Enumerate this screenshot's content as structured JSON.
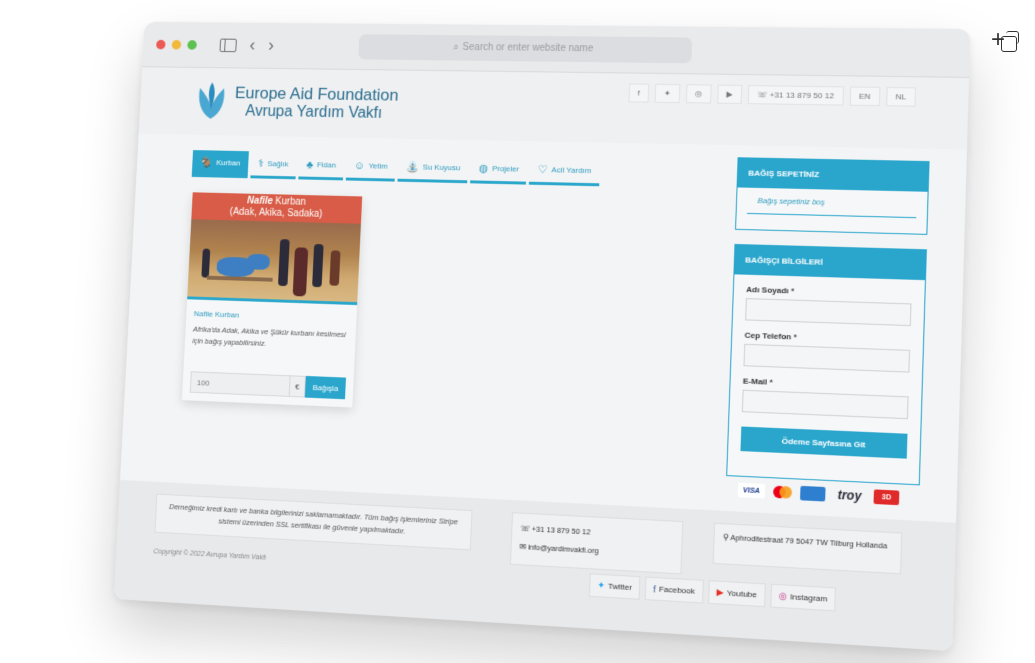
{
  "browser": {
    "address_placeholder": "Search or enter website name"
  },
  "brand": {
    "line1": "Europe Aid Foundation",
    "line2": "Avrupa Yardım Vakfı"
  },
  "toplinks": {
    "phone": "+31 13 879 50 12",
    "lang_en": "EN",
    "lang_nl": "NL"
  },
  "nav": [
    {
      "label": "Kurban",
      "icon": "goat-icon"
    },
    {
      "label": "Sağlık",
      "icon": "health-icon"
    },
    {
      "label": "Fidan",
      "icon": "sapling-icon"
    },
    {
      "label": "Yetim",
      "icon": "orphan-icon"
    },
    {
      "label": "Su Kuyusu",
      "icon": "well-icon"
    },
    {
      "label": "Projeler",
      "icon": "globe-icon"
    },
    {
      "label": "Acil Yardım",
      "icon": "heart-icon"
    }
  ],
  "product": {
    "banner_bold": "Nafile",
    "banner_rest": " Kurban",
    "banner_sub": "(Adak, Akika, Sadaka)",
    "name": "Nafile Kurban",
    "desc": "Afrika'da Adak, Akika ve Şükür kurbanı kesilmesi için bağış yapabilirsiniz.",
    "amount": "100",
    "currency": "€",
    "button": "Bağışla"
  },
  "basket": {
    "title": "BAĞIŞ SEPETİNİZ",
    "empty": "Bağış sepetiniz boş"
  },
  "donor": {
    "title": "BAĞIŞÇI BİLGİLERİ",
    "name_label": "Adı Soyadı *",
    "phone_label": "Cep Telefon *",
    "email_label": "E-Mail *",
    "submit": "Ödeme Sayfasına Git"
  },
  "payment_logos": [
    "VISA",
    "mastercard",
    "amex",
    "troy",
    "3D"
  ],
  "footer": {
    "security_text": "Derneğimiz kredi kartı ve banka bilgilerinizi saklamamaktadır. Tüm bağış işlemleriniz Stripe sistemi üzerinden SSL sertifikası ile güvenle yapılmaktadır.",
    "phone": "+31 13 879 50 12",
    "email": "info@yardimvakfi.org",
    "address": "Aphroditestraat 79 5047 TW Tilburg Hollanda",
    "copyright": "Copyright © 2022 Avrupa Yardım Vakfı",
    "social": {
      "twitter": "Twitter",
      "facebook": "Facebook",
      "youtube": "Youtube",
      "instagram": "Instagram"
    }
  },
  "colors": {
    "accent": "#2aa6cd",
    "banner": "#d85c47",
    "brand": "#2b6d8f"
  }
}
